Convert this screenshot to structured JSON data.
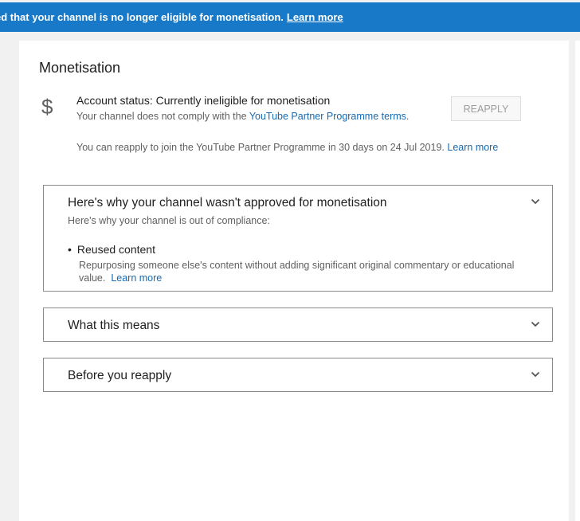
{
  "banner": {
    "text": "ed that your channel is no longer eligible for monetisation.",
    "link": "Learn more"
  },
  "page": {
    "title": "Monetisation"
  },
  "account": {
    "icon": "dollar-icon",
    "icon_glyph": "$",
    "status": "Account status: Currently ineligible for monetisation",
    "comply_prefix": "Your channel does not comply with the",
    "comply_link": "YouTube Partner Programme terms",
    "comply_suffix": ".",
    "reapply_button": "REAPPLY",
    "reapply_info": "You can reapply to join the YouTube Partner Programme in 30 days on 24 Jul 2019.",
    "reapply_link": "Learn more"
  },
  "panels": [
    {
      "heading": "Here's why your channel wasn't approved for monetisation",
      "subheading": "Here's why your channel is out of compliance:",
      "reason_title": "Reused content",
      "reason_desc": "Repurposing someone else's content without adding significant original commentary or educational value.",
      "reason_link": "Learn more"
    },
    {
      "heading": "What this means"
    },
    {
      "heading": "Before you reapply"
    }
  ],
  "colors": {
    "banner": "#1779c8",
    "link": "#1769b0",
    "background": "#f1f1f1"
  }
}
